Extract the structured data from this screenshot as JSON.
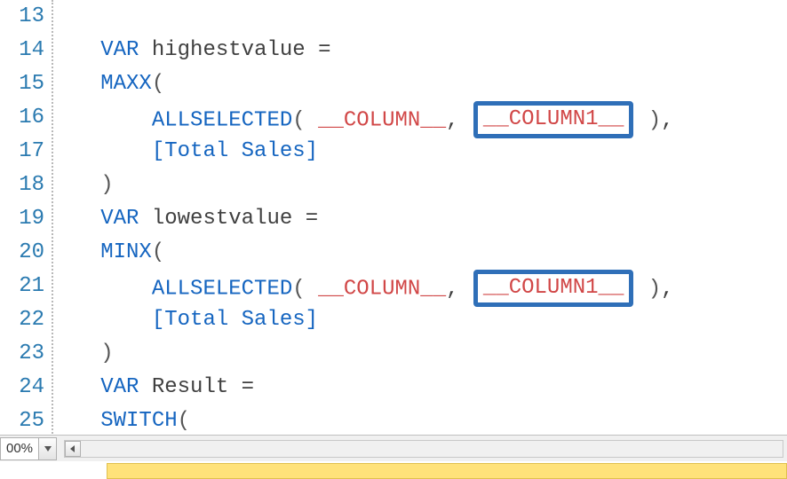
{
  "gutter": {
    "start": 13,
    "end": 25
  },
  "tokens": {
    "var": "VAR",
    "maxx": "MAXX",
    "minx": "MINX",
    "allselected": "ALLSELECTED",
    "switch": "SWITCH",
    "column": "__COLUMN__",
    "column1": "__COLUMN1__",
    "totalSales": "[Total Sales]",
    "highestvalue": "highestvalue",
    "lowestvalue": "lowestvalue",
    "result": "Result"
  },
  "bottomBar": {
    "zoom": "00%"
  }
}
